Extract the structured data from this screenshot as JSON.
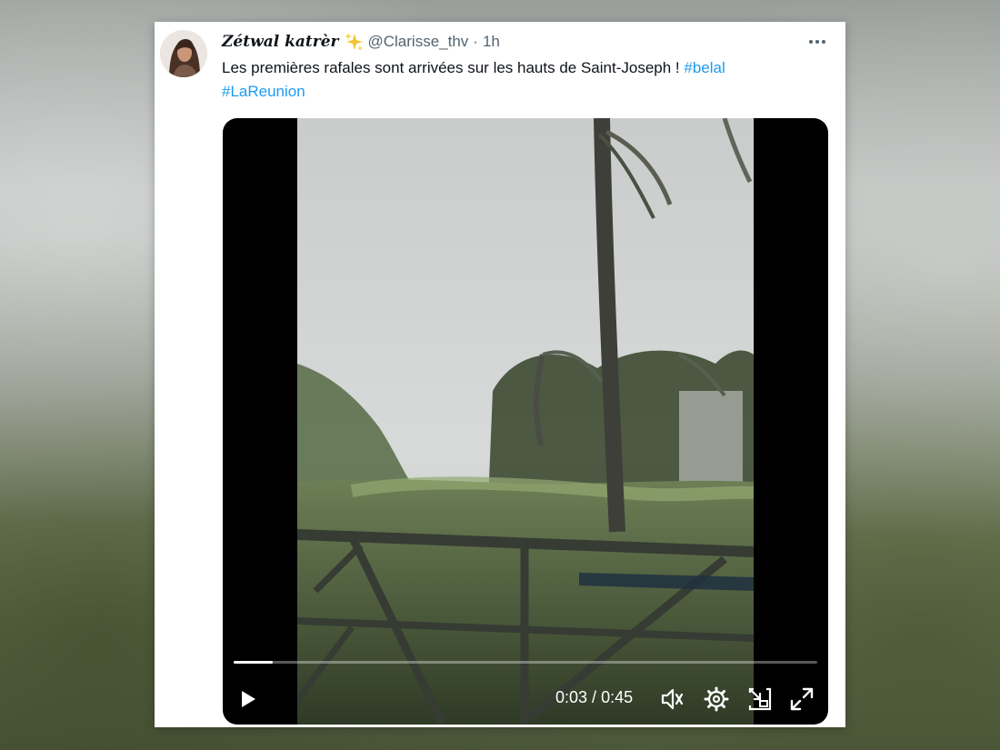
{
  "tweet": {
    "display_name": "Zétwal katrèr",
    "handle": "@Clarisse_thv",
    "separator": "·",
    "time_ago": "1h",
    "text": "Les premières rafales sont arrivées sur les hauts de Saint-Joseph !",
    "hashtags": [
      "#belal",
      "#LaReunion"
    ]
  },
  "video": {
    "current_time": "0:03",
    "time_separator": " / ",
    "duration": "0:45",
    "progress_fraction": 0.067
  },
  "icons": {
    "badge": "sparkles-icon",
    "menu": "more-horizontal-icon",
    "play": "play-icon",
    "volume": "volume-icon",
    "settings": "gear-icon",
    "pip": "picture-in-picture-icon",
    "fullscreen": "fullscreen-expand-icon"
  },
  "colors": {
    "hashtag": "#1d9bf0",
    "badge": "#f4c430",
    "text": "#0f1419",
    "secondary": "#536471"
  }
}
